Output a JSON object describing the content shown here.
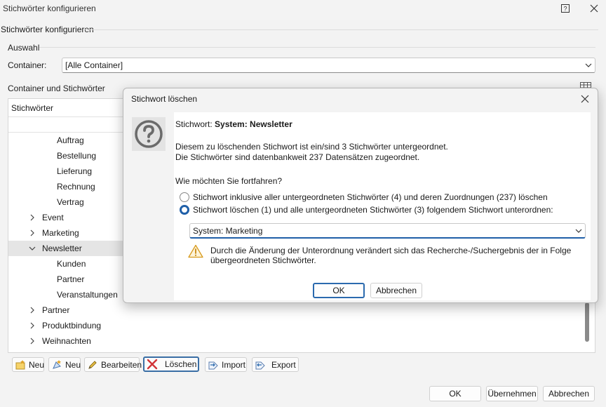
{
  "window": {
    "title": "Stichwörter konfigurieren",
    "help_icon": "help-icon",
    "close_icon": "close-icon"
  },
  "header": {
    "title": "Stichwörter konfigurieren"
  },
  "selection": {
    "group_label": "Auswahl",
    "container_label": "Container:",
    "container_value": "[Alle Container]"
  },
  "tree_section": {
    "group_label": "Container und Stichwörter",
    "column_header": "Stichwörter",
    "rows": [
      {
        "label": "Auftrag",
        "level": 2,
        "expander": ""
      },
      {
        "label": "Bestellung",
        "level": 2,
        "expander": ""
      },
      {
        "label": "Lieferung",
        "level": 2,
        "expander": ""
      },
      {
        "label": "Rechnung",
        "level": 2,
        "expander": ""
      },
      {
        "label": "Vertrag",
        "level": 2,
        "expander": ""
      },
      {
        "label": "Event",
        "level": 1,
        "expander": "collapsed"
      },
      {
        "label": "Marketing",
        "level": 1,
        "expander": "collapsed"
      },
      {
        "label": "Newsletter",
        "level": 1,
        "expander": "expanded",
        "selected": true
      },
      {
        "label": "Kunden",
        "level": 2,
        "expander": ""
      },
      {
        "label": "Partner",
        "level": 2,
        "expander": ""
      },
      {
        "label": "Veranstaltungen",
        "level": 2,
        "expander": ""
      },
      {
        "label": "Partner",
        "level": 1,
        "expander": "collapsed"
      },
      {
        "label": "Produktbindung",
        "level": 1,
        "expander": "collapsed"
      },
      {
        "label": "Weihnachten",
        "level": 1,
        "expander": "collapsed"
      }
    ]
  },
  "toolbar": {
    "new1": "Neu",
    "new2": "Neu",
    "edit": "Bearbeiten",
    "delete": "Löschen",
    "import": "Import",
    "export": "Export"
  },
  "footer": {
    "ok": "OK",
    "apply": "Übernehmen",
    "cancel": "Abbrechen"
  },
  "dialog": {
    "title": "Stichwort löschen",
    "keyword_prefix": "Stichwort:",
    "keyword_name": "System: Newsletter",
    "info_line1": "Diesem zu löschenden Stichwort ist ein/sind 3 Stichwörter untergeordnet.",
    "info_line2": "Die Stichwörter sind datenbankweit 237 Datensätzen zugeordnet.",
    "question": "Wie möchten Sie fortfahren?",
    "option1": "Stichwort inklusive aller untergeordneten Stichwörter (4) und deren Zuordnungen (237) löschen",
    "option2": "Stichwort löschen (1) und alle untergeordneten Stichwörter (3) folgendem Stichwort unterordnen:",
    "selected_option": 2,
    "target_value": "System: Marketing",
    "warning_line1": "Durch die Änderung der Unterordnung verändert sich das Recherche-/Suchergebnis der in Folge",
    "warning_line2": "übergeordneten Stichwörter.",
    "ok": "OK",
    "cancel": "Abbrechen"
  },
  "colors": {
    "accent": "#1f5fa8",
    "background": "#f3f3f3",
    "selection": "#e5e5e5",
    "delete_red": "#d13438",
    "warning": "#f0b429"
  }
}
